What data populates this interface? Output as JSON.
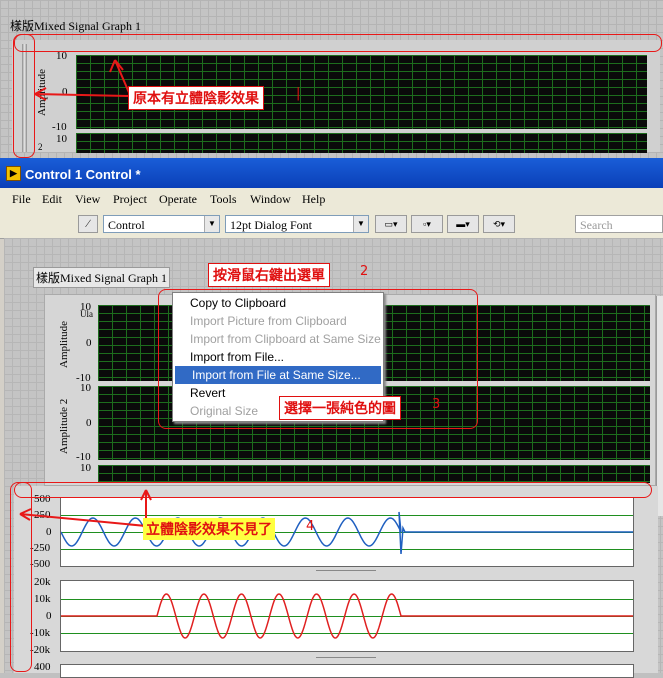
{
  "top_graph": {
    "label": "樣版Mixed Signal Graph 1",
    "ylabel": "Amplitude",
    "ticks": [
      "10",
      "0",
      "-10",
      "10"
    ],
    "ylabel2": "2"
  },
  "annotations": {
    "note1": "原本有立體陰影效果",
    "note2": "按滑鼠右鍵出選單",
    "note2_num": "2",
    "note3": "選擇一張純色的圖",
    "note3_num": "3",
    "note4": "立體陰影效果不見了",
    "note4_num": "4",
    "cursor_mark": "|"
  },
  "window": {
    "title": "Control 1 Control *",
    "menu": [
      "File",
      "Edit",
      "View",
      "Project",
      "Operate",
      "Tools",
      "Window",
      "Help"
    ],
    "toolbar": {
      "control_select": "Control",
      "font_select": "12pt Dialog Font",
      "search_placeholder": "Search"
    }
  },
  "inner_graph": {
    "label": "樣版Mixed Signal Graph 1",
    "ylabel1": "Amplitude",
    "ylabel2": "Amplitude 2",
    "ticks_p1": [
      "10",
      "0",
      "-10"
    ],
    "ticks_p2": [
      "10",
      "0",
      "-10"
    ],
    "ticks_p3": [
      "10"
    ],
    "tick_overlap": "Ula"
  },
  "context_menu": {
    "items": [
      {
        "label": "Copy to Clipboard",
        "state": "enabled"
      },
      {
        "label": "Import Picture from Clipboard",
        "state": "disabled"
      },
      {
        "label": "Import from Clipboard at Same Size",
        "state": "disabled"
      },
      {
        "label": "Import from File...",
        "state": "enabled"
      },
      {
        "label": "Import from File at Same Size...",
        "state": "highlighted"
      },
      {
        "label": "Revert",
        "state": "enabled"
      },
      {
        "label": "Original Size",
        "state": "disabled"
      }
    ]
  },
  "wave_graph": {
    "ticks_a": [
      "500",
      "250",
      "0",
      "-250",
      "-500"
    ],
    "ticks_b": [
      "20k",
      "10k",
      "0",
      "-10k",
      "-20k"
    ],
    "ticks_c": [
      "400"
    ],
    "colors": {
      "wave_a": "#1f5fc0",
      "wave_b": "#e02020",
      "grid": "#1f8f1f"
    }
  }
}
